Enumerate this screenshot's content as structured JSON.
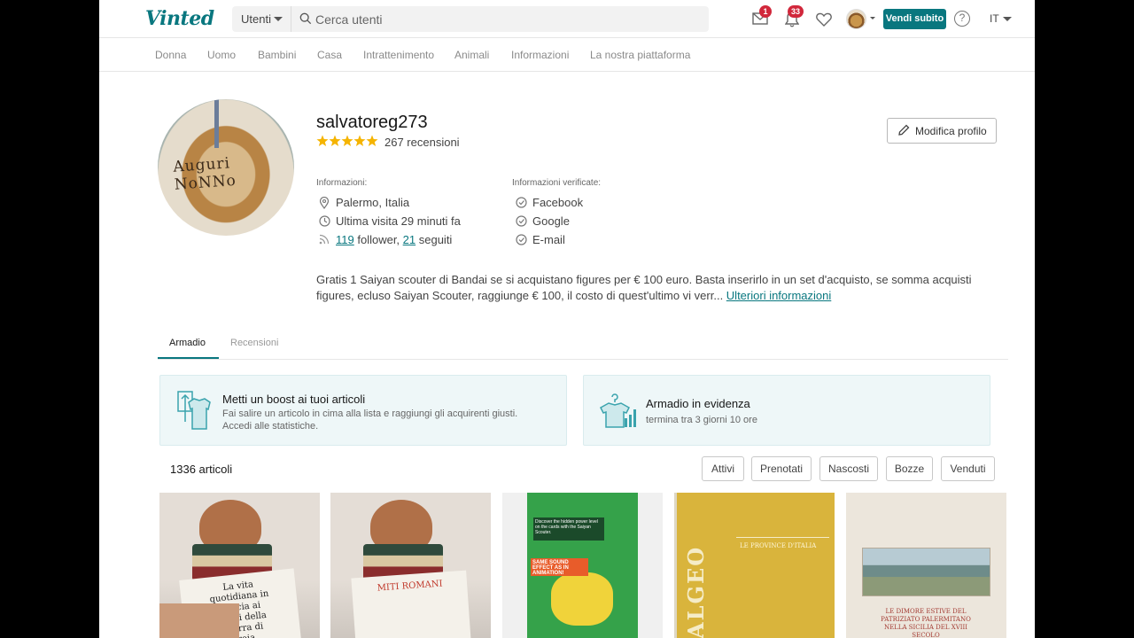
{
  "header": {
    "logo": "Vinted",
    "search": {
      "category": "Utenti",
      "placeholder": "Cerca utenti"
    },
    "messages_badge": "1",
    "notifications_badge": "33",
    "sell_button": "Vendi subito",
    "help": "?",
    "language": "IT"
  },
  "category_nav": [
    "Donna",
    "Uomo",
    "Bambini",
    "Casa",
    "Intrattenimento",
    "Animali",
    "Informazioni",
    "La nostra piattaforma"
  ],
  "profile": {
    "photo_text": "Auguri NoNNo",
    "username": "salvatoreg273",
    "rating_stars": 5,
    "reviews": "267 recensioni",
    "edit_button": "Modifica profilo",
    "info_heading": "Informazioni:",
    "location": "Palermo, Italia",
    "last_seen": "Ultima visita 29 minuti fa",
    "followers_count": "119",
    "followers_label": " follower, ",
    "following_count": "21",
    "following_label": " seguiti",
    "verified_heading": "Informazioni verificate:",
    "verified": [
      "Facebook",
      "Google",
      "E-mail"
    ],
    "about": "Gratis 1 Saiyan scouter di Bandai se si acquistano figures per € 100 euro. Basta inserirlo in un set d'acquisto, se somma acquisti figures, ecluso Saiyan Scouter, raggiunge € 100, il costo di quest'ultimo vi verr... ",
    "about_more": "Ulteriori informazioni"
  },
  "tabs": {
    "active": "Armadio",
    "other": "Recensioni"
  },
  "promos": [
    {
      "title": "Metti un boost ai tuoi articoli",
      "subtitle": "Fai salire un articolo in cima alla lista e raggiungi gli acquirenti giusti.",
      "link": "Accedi alle statistiche."
    },
    {
      "title": "Armadio in evidenza",
      "subtitle": "termina tra 3 giorni 10 ore"
    }
  ],
  "items_count": "1336 articoli",
  "filters": [
    "Attivi",
    "Prenotati",
    "Nascosti",
    "Bozze",
    "Venduti"
  ],
  "items": [
    {
      "cover_text": "La vita quotidiana in Grecia ai tempi della guerra di Troia"
    },
    {
      "cover_text": "MITI ROMANI"
    },
    {
      "cover_text": "Discover the hidden power level on the cards with the Saiyan Scouter.",
      "banner": "SAME SOUND EFFECT AS IN ANIMATION!"
    },
    {
      "spine": "ALGEO",
      "title": "LE PROVINCE D'ITALIA"
    },
    {
      "caption": "LE DIMORE ESTIVE DEL PATRIZIATO PALERMITANO NELLA SICILIA DEL XVIII SECOLO"
    }
  ],
  "colors": {
    "brand": "#09777f",
    "badge": "#d1273b",
    "star": "#f5b400"
  }
}
